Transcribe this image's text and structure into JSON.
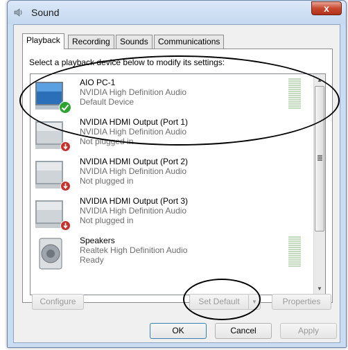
{
  "window": {
    "title": "Sound",
    "close_glyph": "x"
  },
  "tabs": [
    {
      "label": "Playback",
      "active": true
    },
    {
      "label": "Recording",
      "active": false
    },
    {
      "label": "Sounds",
      "active": false
    },
    {
      "label": "Communications",
      "active": false
    }
  ],
  "instruction": "Select a playback device below to modify its settings:",
  "devices": [
    {
      "name": "AIO PC-1",
      "driver": "NVIDIA High Definition Audio",
      "status": "Default Device",
      "icon": "monitor-icon",
      "badge": "green-check-icon"
    },
    {
      "name": "NVIDIA HDMI Output (Port 1)",
      "driver": "NVIDIA High Definition Audio",
      "status": "Not plugged in",
      "icon": "monitor-icon",
      "badge": "red-down-arrow-icon"
    },
    {
      "name": "NVIDIA HDMI Output (Port 2)",
      "driver": "NVIDIA High Definition Audio",
      "status": "Not plugged in",
      "icon": "monitor-icon",
      "badge": "red-down-arrow-icon"
    },
    {
      "name": "NVIDIA HDMI Output (Port 3)",
      "driver": "NVIDIA High Definition Audio",
      "status": "Not plugged in",
      "icon": "monitor-icon",
      "badge": "red-down-arrow-icon"
    },
    {
      "name": "Speakers",
      "driver": "Realtek High Definition Audio",
      "status": "Ready",
      "icon": "speaker-icon",
      "badge": null
    }
  ],
  "buttons": {
    "configure": "Configure",
    "set_default": "Set Default",
    "properties": "Properties",
    "ok": "OK",
    "cancel": "Cancel",
    "apply": "Apply"
  },
  "colors": {
    "title_bar": "#c4d8f0",
    "close_button": "#c8492f",
    "check_badge": "#2fa332",
    "unplugged_badge": "#c7302b",
    "level_meter": "#c3d9bd",
    "annotation_ring": "#000000"
  }
}
